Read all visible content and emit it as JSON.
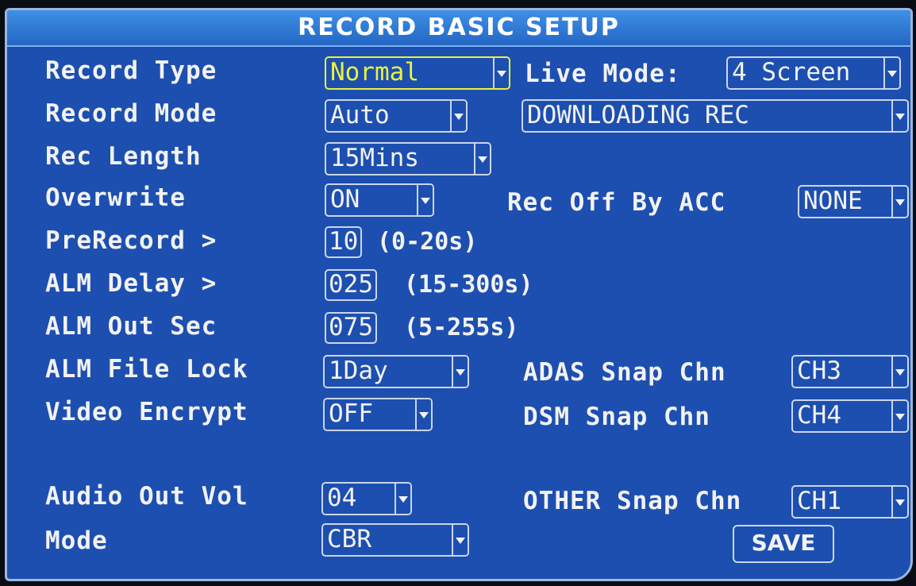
{
  "window": {
    "title": "RECORD BASIC SETUP"
  },
  "labels": {
    "record_type": "Record Type",
    "live_mode": "Live Mode:",
    "record_mode": "Record Mode",
    "rec_length": "Rec Length",
    "overwrite": "Overwrite",
    "rec_off_by_acc": "Rec Off By ACC",
    "prerecord": "PreRecord >",
    "alm_delay": "ALM Delay >",
    "alm_out_sec": "ALM Out Sec",
    "alm_file_lock": "ALM File Lock",
    "adas_snap_chn": "ADAS Snap Chn",
    "video_encrypt": "Video Encrypt",
    "dsm_snap_chn": "DSM Snap Chn",
    "audio_out_vol": "Audio Out Vol",
    "other_snap_chn": "OTHER Snap Chn",
    "mode": "Mode"
  },
  "values": {
    "record_type": "Normal",
    "live_mode": "4 Screen",
    "record_mode": "Auto",
    "record_mode_option": "DOWNLOADING REC",
    "rec_length": "15Mins",
    "overwrite": "ON",
    "rec_off_by_acc": "NONE",
    "prerecord": "10",
    "alm_delay": "025",
    "alm_out_sec": "075",
    "alm_file_lock": "1Day",
    "adas_snap_chn": "CH3",
    "video_encrypt": "OFF",
    "dsm_snap_chn": "CH4",
    "audio_out_vol": "04",
    "other_snap_chn": "CH1",
    "mode": "CBR"
  },
  "ranges": {
    "prerecord": "(0-20s)",
    "alm_delay": "(15-300s)",
    "alm_out_sec": "(5-255s)"
  },
  "buttons": {
    "save": "SAVE"
  },
  "colors": {
    "background": "#1d4fb0",
    "title_bar": "#3f8fe6",
    "selected": "#e8f23c",
    "text": "#f2f2f2"
  }
}
